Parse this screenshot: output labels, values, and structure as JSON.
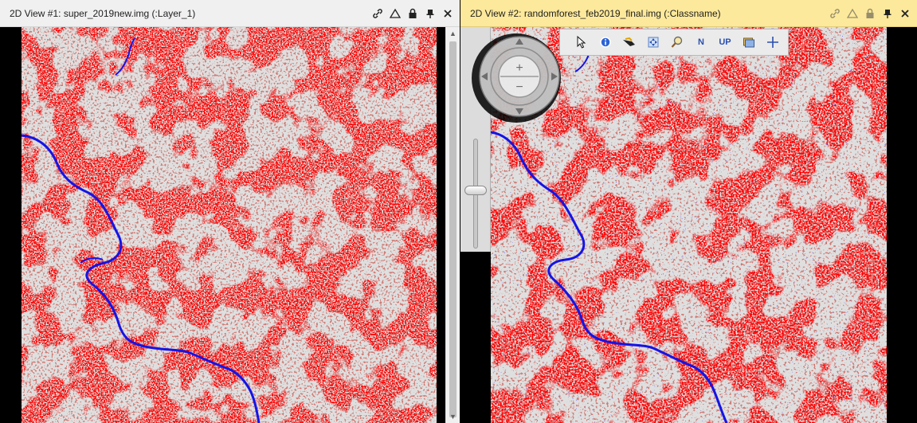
{
  "views": [
    {
      "title": "2D View #1: super_2019new.img (:Layer_1)",
      "active": false
    },
    {
      "title": "2D View #2: randomforest_feb2019_final.img (:Classname)",
      "active": true
    }
  ],
  "titlebar_icons": [
    "link-icon",
    "triangle-icon",
    "lock-icon",
    "pin-icon",
    "close-icon"
  ],
  "scrollbar": {
    "up_glyph": "▲",
    "down_glyph": "▼"
  },
  "navigation": {
    "zoom_in_glyph": "+",
    "zoom_out_glyph": "−"
  },
  "toolstrip": {
    "tools": [
      {
        "name": "select-tool",
        "icon": "cursor-icon"
      },
      {
        "name": "info-tool",
        "icon": "info-icon"
      },
      {
        "name": "roam-tool",
        "icon": "hand-icon"
      },
      {
        "name": "fit-tool",
        "icon": "fit-icon"
      },
      {
        "name": "zoom-tool",
        "icon": "magnifier-icon"
      },
      {
        "name": "north-up-tool",
        "label": "N"
      },
      {
        "name": "up-tool",
        "label": "UP"
      },
      {
        "name": "layers-tool",
        "icon": "layers-icon"
      },
      {
        "name": "crosshair-tool",
        "icon": "crosshair-icon"
      }
    ]
  },
  "colors": {
    "class_red": "#ff0000",
    "class_gray": "#bdbdbd",
    "class_brown": "#a0332e",
    "class_blue": "#1414e6",
    "active_titlebar": "#fde99b",
    "inactive_titlebar": "#f0f0f0"
  }
}
